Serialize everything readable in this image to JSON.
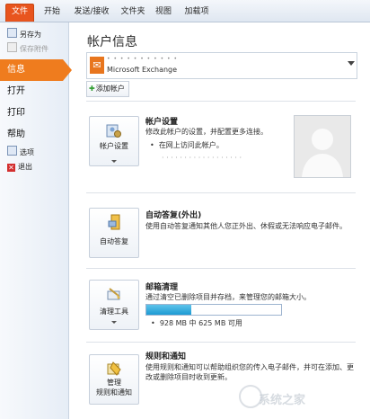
{
  "ribbon": {
    "tabs": [
      {
        "label": "文件",
        "active": true
      },
      {
        "label": "开始"
      },
      {
        "label": "发送/接收"
      },
      {
        "label": "文件夹"
      },
      {
        "label": "视图"
      },
      {
        "label": "加载项"
      }
    ],
    "accent_color": "#e8541e"
  },
  "nav": {
    "save_as": "另存为",
    "save_attachments": "保存附件",
    "info": "信息",
    "open": "打开",
    "print": "打印",
    "help": "帮助",
    "options": "选项",
    "exit": "退出",
    "active_color": "#ef7c1e"
  },
  "main": {
    "title": "帐户信息",
    "account": {
      "email_masked": "• • • • • • • • • • •",
      "type": "Microsoft Exchange"
    },
    "add_account": "添加帐户",
    "account_settings": {
      "button": "帐户设置",
      "title": "帐户设置",
      "desc": "修改此帐户的设置，并配置更多连接。",
      "link": "在网上访问此帐户。",
      "url_masked": "· · · · · · · · · · · · · · · · · ·"
    },
    "auto_reply": {
      "button": "自动答复",
      "title": "自动答复(外出)",
      "desc": "使用自动答复通知其他人您正外出、休假或无法响应电子邮件。"
    },
    "cleanup": {
      "button": "清理工具",
      "title": "邮箱清理",
      "desc": "通过清空已删除项目并存档，来管理您的邮箱大小。",
      "usage_fraction": 0.33,
      "quota": "928 MB 中 625 MB 可用"
    },
    "rules": {
      "button_line1": "管理",
      "button_line2": "规则和通知",
      "title": "规则和通知",
      "desc": "使用规则和通知可以帮助组织您的传入电子邮件，并可在添加、更改或删除项目时收到更新。"
    }
  },
  "watermark": "系统之家"
}
